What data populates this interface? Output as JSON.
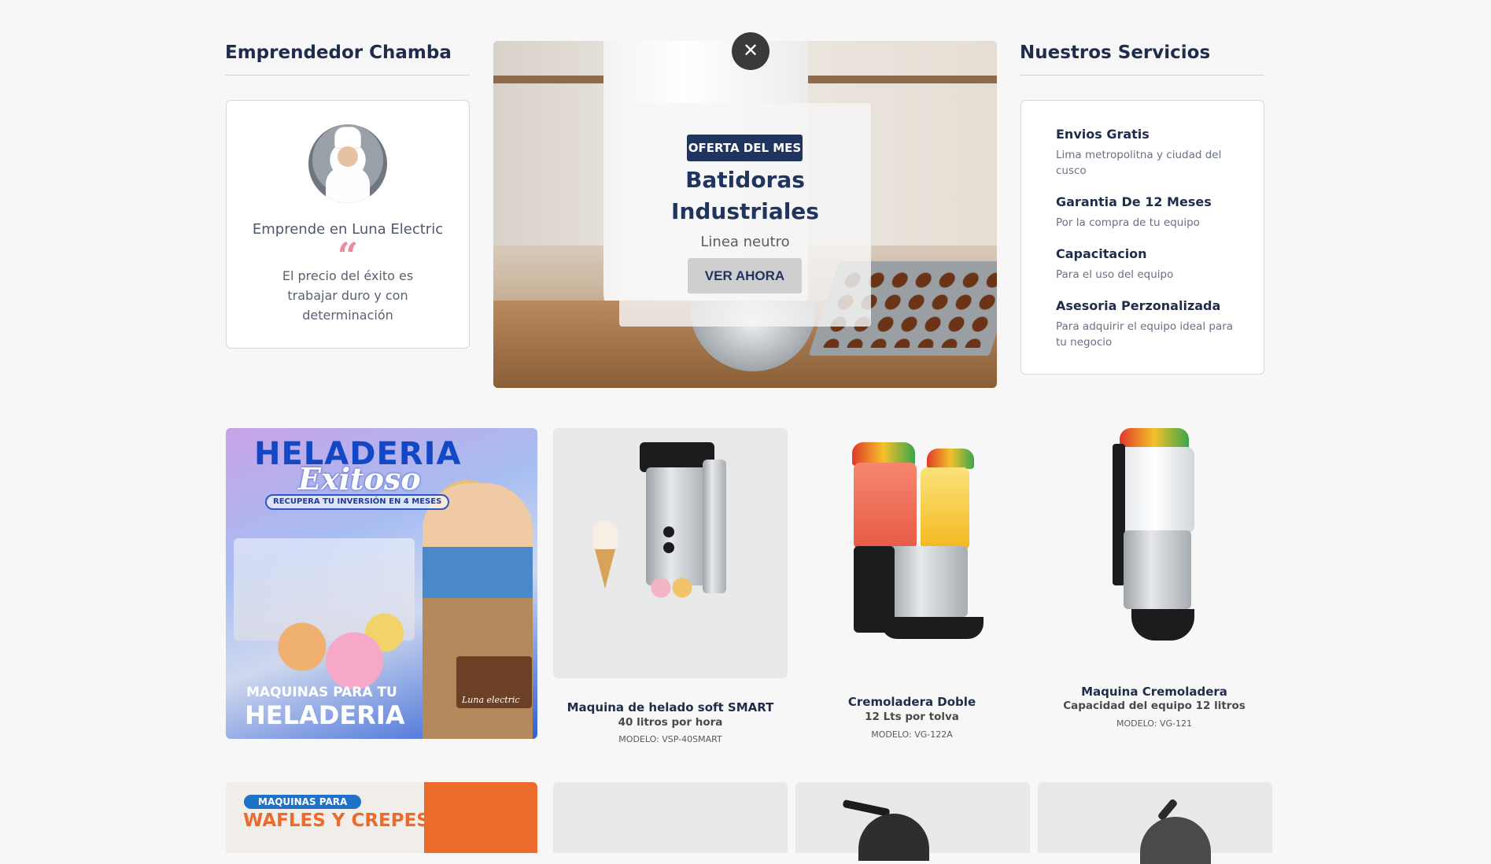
{
  "left_section": {
    "title": "Emprendedor Chamba",
    "card": {
      "name": "Emprende en Luna Electric",
      "quote_mark": "“",
      "quote": "El precio del éxito es trabajar duro y con determinación"
    }
  },
  "hero": {
    "badge": "OFERTA DEL MES",
    "title": "Batidoras Industriales",
    "subtitle": "Linea neutro",
    "cta": "VER AHORA",
    "close": "✕"
  },
  "services": {
    "title": "Nuestros Servicios",
    "items": [
      {
        "title": "Envios Gratis",
        "desc": "Lima metropolitna y ciudad del cusco"
      },
      {
        "title": "Garantia De 12 Meses",
        "desc": "Por la compra de tu equipo"
      },
      {
        "title": "Capacitacion",
        "desc": "Para el uso del equipo"
      },
      {
        "title": "Asesoria Perzonalizada",
        "desc": "Para adquirir el equipo ideal para tu negocio"
      }
    ]
  },
  "promo_heladeria": {
    "line1": "HELADERIA",
    "line2": "Exitoso",
    "pill": "RECUPERA TU INVERSIÓN EN 4 MESES",
    "box_label": "Luna electric",
    "bottom1": "MAQUINAS PARA TU",
    "bottom2": "HELADERIA"
  },
  "products": [
    {
      "name": "Maquina de helado soft SMART",
      "capacity": "40 litros por hora",
      "model": "MODELO: VSP-40SMART"
    },
    {
      "name": "Cremoladera Doble",
      "capacity": "12 Lts por tolva",
      "model": "MODELO: VG-122A"
    },
    {
      "name": "Maquina Cremoladera",
      "capacity": "Capacidad del equipo 12 litros",
      "model": "MODELO: VG-121"
    }
  ],
  "promo_wafles": {
    "pill": "MAQUINAS PARA",
    "title": "WAFLES Y CREPES"
  },
  "colors": {
    "navy": "#1f3560",
    "accent_pink": "#f08a9c",
    "orange": "#ec6a2c"
  }
}
